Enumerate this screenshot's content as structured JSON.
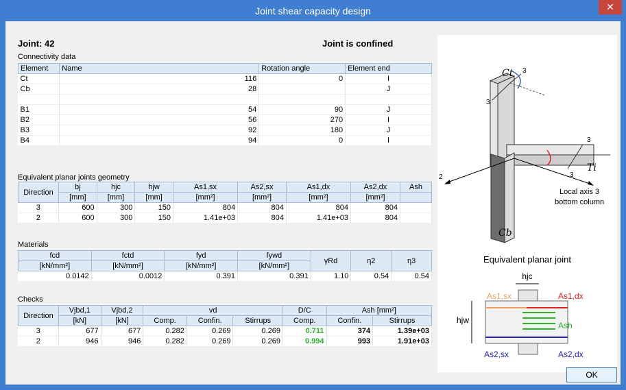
{
  "window": {
    "title": "Joint shear capacity design",
    "close_glyph": "✕"
  },
  "joint": {
    "label": "Joint: 42",
    "status": "Joint is confined"
  },
  "connectivity": {
    "section": "Connectivity data",
    "headers": [
      "Element",
      "Name",
      "Rotation angle",
      "Element end"
    ],
    "rows": [
      [
        "Ct",
        "116",
        "0",
        "I"
      ],
      [
        "Cb",
        "28",
        "",
        "J"
      ],
      [
        "",
        "",
        "",
        ""
      ],
      [
        "B1",
        "54",
        "90",
        "J"
      ],
      [
        "B2",
        "56",
        "270",
        "I"
      ],
      [
        "B3",
        "92",
        "180",
        "J"
      ],
      [
        "B4",
        "94",
        "0",
        "I"
      ]
    ]
  },
  "geometry": {
    "section": "Equivalent planar joints geometry",
    "direction_header": "Direction",
    "headers": [
      "bj",
      "hjc",
      "hjw",
      "As1,sx",
      "As2,sx",
      "As1,dx",
      "As2,dx",
      "Ash"
    ],
    "units": [
      "[mm]",
      "[mm]",
      "[mm]",
      "[mm²]",
      "[mm²]",
      "[mm²]",
      "[mm²]",
      ""
    ],
    "rows": [
      [
        "3",
        "600",
        "300",
        "150",
        "804",
        "804",
        "804",
        "804",
        ""
      ],
      [
        "2",
        "600",
        "300",
        "150",
        "1.41e+03",
        "804",
        "1.41e+03",
        "804",
        ""
      ]
    ]
  },
  "materials": {
    "section": "Materials",
    "headers": [
      "fcd",
      "fctd",
      "fyd",
      "fywd",
      "γRd",
      "η2",
      "η3"
    ],
    "units": [
      "[kN/mm²]",
      "[kN/mm²]",
      "[kN/mm²]",
      "[kN/mm²]"
    ],
    "values": [
      "0.0142",
      "0.0012",
      "0.391",
      "0.391",
      "1.10",
      "0.54",
      "0.54"
    ]
  },
  "checks": {
    "section": "Checks",
    "direction_header": "Direction",
    "group_headers": [
      "Vjbd,1",
      "Vjbd,2",
      "vd",
      "D/C",
      "Ash [mm²]"
    ],
    "sub_headers": [
      "[kN]",
      "[kN]",
      "Comp.",
      "Confin.",
      "Stirrups",
      "Comp.",
      "Confin.",
      "Stirrups"
    ],
    "rows": [
      [
        "3",
        "677",
        "677",
        "0.282",
        "0.269",
        "0.269",
        "0.711",
        "374",
        "1.39e+03"
      ],
      [
        "2",
        "946",
        "946",
        "0.282",
        "0.269",
        "0.269",
        "0.994",
        "993",
        "1.91e+03"
      ]
    ]
  },
  "diagram": {
    "ct": "Ct",
    "cb": "Cb",
    "ti": "Ti",
    "axis3": "3",
    "axis2": "2",
    "local_axis": "Local axis 3",
    "bottom_column": "bottom column",
    "planar_title": "Equivalent planar joint",
    "hjc": "hjc",
    "hjw": "hjw",
    "as1sx": "As1,sx",
    "as1dx": "As1,dx",
    "ash": "Ash",
    "as2sx": "As2,sx",
    "as2dx": "As2,dx"
  },
  "ok_label": "OK",
  "colors": {
    "titlebar": "#3f7ed0",
    "green": "#2db52d",
    "red": "#e0201b",
    "blue": "#2226b8",
    "orange": "#f0a060"
  }
}
